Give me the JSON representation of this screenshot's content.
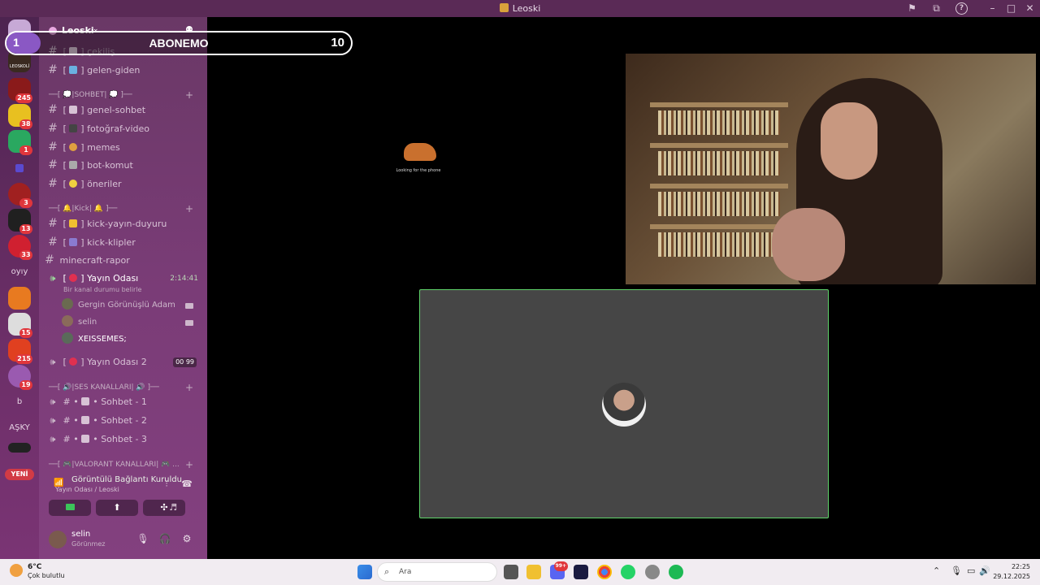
{
  "window": {
    "title": "Leoski"
  },
  "overlay": {
    "left_value": "1",
    "label": "ABONEMO",
    "right_value": "10",
    "progress": 0.1,
    "fill_color": "#8a58c4"
  },
  "rail": {
    "badges": [
      "245",
      "38",
      "1",
      "3",
      "13",
      "33",
      "15",
      "215",
      "19"
    ],
    "text_servers": [
      "oyıy",
      "b",
      "AŞKY"
    ],
    "new_label": "YENİ",
    "leoskoli_label": "LEOSKOLİ"
  },
  "server": {
    "name": "Leoski"
  },
  "channels": {
    "cekilis": "çekiliş",
    "gelen_giden": "gelen-giden",
    "cat_sohbet": "──[ 💭|SOHBET| 💭 ]──",
    "genel_sohbet": "genel-sohbet",
    "fotograf_video": "fotoğraf-video",
    "memes": "memes",
    "bot_komut": "bot-komut",
    "oneriler": "öneriler",
    "cat_kick": "──[ 🔔|Kick| 🔔 ]──",
    "kick_yayin_duyuru": "kick-yayın-duyuru",
    "kick_klipler": "kick-klipler",
    "minecraft_rapor": "minecraft-rapor",
    "yayin_odasi": "Yayın Odası",
    "yayin_timer": "2:14:41",
    "yayin_note": "Bir kanal durumu belirle",
    "user1": "Gergin Görünüşlü Adam",
    "user2": "selin",
    "user3": "XEISSEMES;",
    "yayin_odasi_2": "Yayın Odası 2",
    "yayin2_count_left": "00",
    "yayin2_count_right": "99",
    "cat_ses": "──[ 🔊|SES KANALLARI| 🔊 ]──",
    "sohbet1": "Sohbet - 1",
    "sohbet2": "Sohbet - 2",
    "sohbet3": "Sohbet - 3",
    "cat_valorant": "──[ 🎮|VALORANT KANALLARI| 🎮 ..."
  },
  "voice": {
    "status": "Görüntülü Bağlantı Kuruldu",
    "location": "Yayın Odası / Leoski",
    "status_color": "#9bd59a"
  },
  "user": {
    "name": "selin",
    "status": "Görünmez"
  },
  "stage": {
    "gif_caption": "Looking for the phone",
    "tile_border_color": "#5fd46a"
  },
  "taskbar": {
    "temp": "6°C",
    "condition": "Çok bulutlu",
    "search_placeholder": "Ara",
    "time": "22:25",
    "date": "29.12.2025",
    "discord_badge": "99+"
  }
}
